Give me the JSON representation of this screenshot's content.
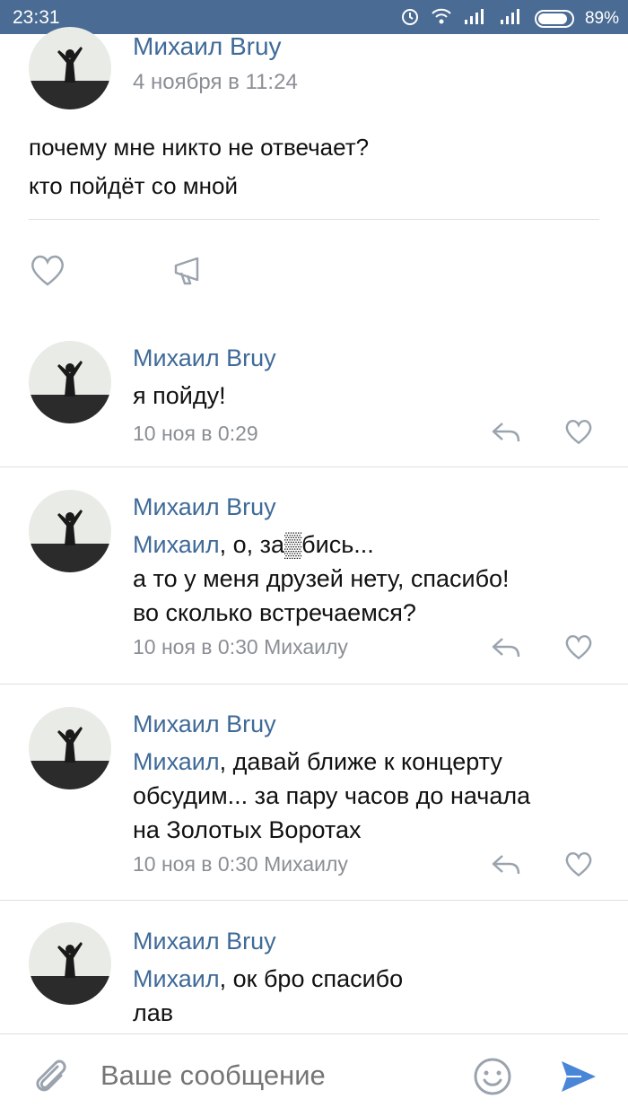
{
  "status_bar": {
    "time": "23:31",
    "battery": "89%"
  },
  "post": {
    "author": "Михаил Bruy",
    "date": "4 ноября в 11:24",
    "lines": [
      "почему мне никто не отвечает?",
      "кто пойдёт со мной"
    ]
  },
  "comments": [
    {
      "author": "Михаил Bruy",
      "mention": "",
      "text": "я пойду!",
      "meta": "10 ноя в 0:29"
    },
    {
      "author": "Михаил Bruy",
      "mention": "Михаил",
      "text": ", о, за▒бись...\nа то у меня друзей нету, спасибо!\nво сколько встречаемся?",
      "meta": "10 ноя в 0:30 Михаилу"
    },
    {
      "author": "Михаил Bruy",
      "mention": "Михаил",
      "text": ", давай ближе к концерту\nобсудим... за пару часов до начала\nна Золотых Воротах",
      "meta": "10 ноя в 0:30 Михаилу"
    },
    {
      "author": "Михаил Bruy",
      "mention": "Михаил",
      "text": ", ок бро спасибо\nлав",
      "meta": ""
    }
  ],
  "composer": {
    "placeholder": "Ваше сообщение"
  },
  "colors": {
    "accent": "#3f6a98",
    "status_bar": "#4a6b93",
    "send": "#4a86d8"
  },
  "icons": [
    "alarm-icon",
    "wifi-icon",
    "signal-icon",
    "battery-icon",
    "heart-icon",
    "share-icon",
    "reply-icon",
    "attach-icon",
    "emoji-icon",
    "send-icon"
  ]
}
